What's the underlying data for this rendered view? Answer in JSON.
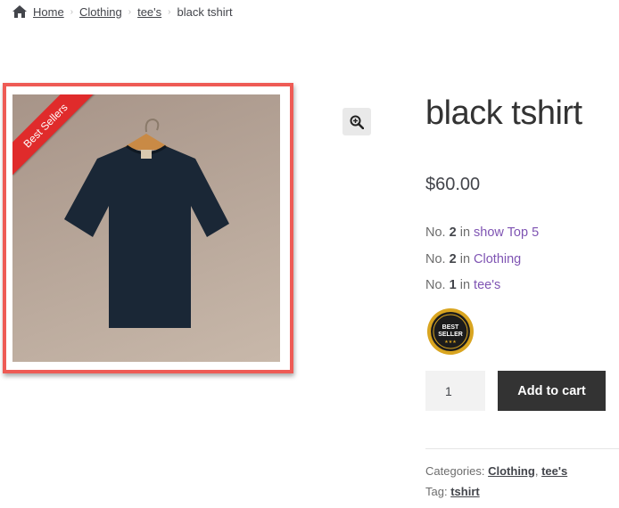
{
  "breadcrumb": {
    "home": "Home",
    "items": [
      "Clothing",
      "tee's"
    ],
    "current": "black tshirt"
  },
  "product": {
    "ribbon": "Best Sellers",
    "title": "black tshirt",
    "price": "$60.00",
    "rankings": [
      {
        "prefix": "No.",
        "number": "2",
        "in": "in",
        "link": "show Top 5"
      },
      {
        "prefix": "No.",
        "number": "2",
        "in": "in",
        "link": "Clothing"
      },
      {
        "prefix": "No.",
        "number": "1",
        "in": "in",
        "link": "tee's"
      }
    ],
    "badge": {
      "line1": "BEST",
      "line2": "SELLER",
      "stars": "★★★"
    },
    "quantity": "1",
    "add_to_cart": "Add to cart"
  },
  "meta": {
    "categories_label": "Categories:",
    "categories": [
      "Clothing",
      "tee's"
    ],
    "separator": ",",
    "tag_label": "Tag:",
    "tag": "tshirt"
  },
  "colors": {
    "accent_link": "#7f54b3",
    "frame_border": "#ee5b55",
    "ribbon": "#e02b2b",
    "button_dark": "#333333"
  },
  "icons": [
    "home-icon",
    "zoom-icon",
    "best-seller-badge"
  ]
}
